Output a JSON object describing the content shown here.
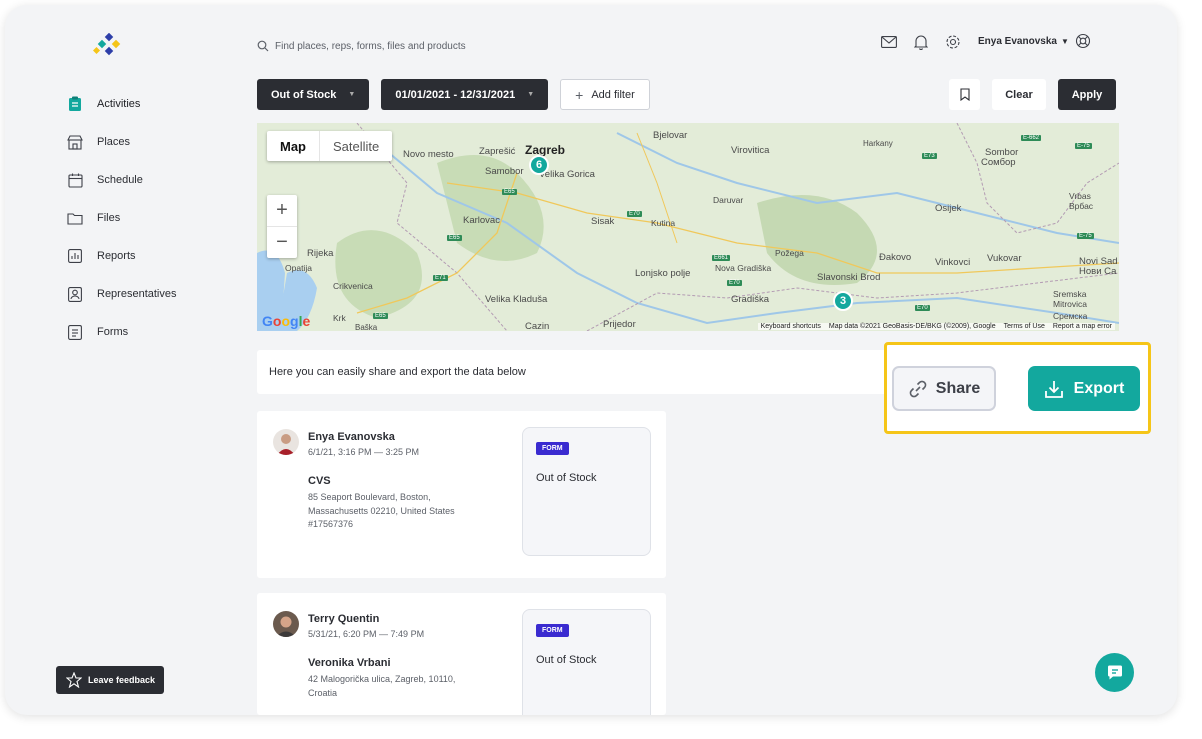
{
  "search": {
    "placeholder": "Find places, reps, forms, files and products"
  },
  "user": {
    "name": "Enya Evanovska"
  },
  "sidebar": {
    "items": [
      {
        "label": "Activities"
      },
      {
        "label": "Places"
      },
      {
        "label": "Schedule"
      },
      {
        "label": "Files"
      },
      {
        "label": "Reports"
      },
      {
        "label": "Representatives"
      },
      {
        "label": "Forms"
      }
    ],
    "feedback": "Leave feedback"
  },
  "filters": {
    "status": "Out of Stock",
    "date_range": "01/01/2021 - 12/31/2021",
    "add_filter": "Add filter",
    "clear": "Clear",
    "apply": "Apply"
  },
  "map": {
    "tab_map": "Map",
    "tab_satellite": "Satellite",
    "zoom_in": "+",
    "zoom_out": "−",
    "clusters": [
      "6",
      "3"
    ],
    "cities": [
      "Zagreb",
      "Zaprešić",
      "Novo mesto",
      "Samobor",
      "Velika Gorica",
      "Bjelovar",
      "Virovitica",
      "Harkany",
      "Sombor",
      "Сомбор",
      "Osijek",
      "Vrbas",
      "Врбас",
      "Karlovac",
      "Sisak",
      "Kutina",
      "Daruvar",
      "Rijeka",
      "Opatija",
      "Crikvenica",
      "Lonjsko polje",
      "Nova Gradiška",
      "Požega",
      "Slavonski Brod",
      "Đakovo",
      "Vinkovci",
      "Vukovar",
      "Novi Sad",
      "Нови Са",
      "Velika Kladuša",
      "Gradiška",
      "Sremska Mitrovica",
      "Сремска",
      "Krk",
      "Baška",
      "Cazin",
      "Prijedor"
    ],
    "attribution": [
      "Keyboard shortcuts",
      "Map data ©2021 GeoBasis-DE/BKG (©2009), Google",
      "Terms of Use",
      "Report a map error"
    ],
    "google": "Google"
  },
  "info_text": "Here you can easily share and export the data below",
  "actions": {
    "share": "Share",
    "export": "Export"
  },
  "cards": [
    {
      "name": "Enya Evanovska",
      "time": "6/1/21, 3:16 PM — 3:25 PM",
      "place": "CVS",
      "address": "85 Seaport Boulevard, Boston, Massachusetts 02210, United States",
      "id": "#17567376",
      "badge": "FORM",
      "form_name": "Out of Stock"
    },
    {
      "name": "Terry Quentin",
      "time": "5/31/21, 6:20 PM — 7:49 PM",
      "place": "Veronika Vrbani",
      "address": "42 Malogorička ulica, Zagreb, 10110, Croatia",
      "badge": "FORM",
      "form_name": "Out of Stock"
    }
  ],
  "colors": {
    "accent": "#13a89e",
    "dark": "#2b2d33",
    "badge": "#3a2bd0",
    "highlight": "#f5c518"
  }
}
